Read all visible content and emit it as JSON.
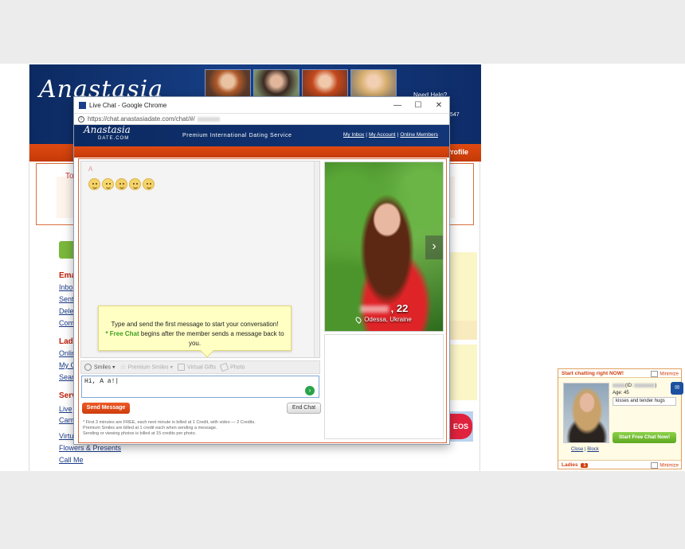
{
  "site": {
    "logo": "Anastasia",
    "help": "Need Help?",
    "phone": "547",
    "profile_link": "Profile",
    "box_to": "To",
    "sections": [
      {
        "label": "Ema",
        "links": [
          "Inbo",
          "Sent",
          "Dele",
          "Com"
        ]
      },
      {
        "label": "Ladi",
        "links": [
          "Onlin",
          "My C",
          "Sear"
        ]
      },
      {
        "label": "Serv",
        "links": [
          "Live",
          "Cam",
          "Virtu",
          "Flowers & Presents",
          "Call Me"
        ]
      }
    ],
    "right_button": "EOS"
  },
  "window": {
    "title": "Live Chat - Google Chrome",
    "minimize": "—",
    "maximize": "☐",
    "close": "✕",
    "url": "https://chat.anastasiadate.com/chat/#/"
  },
  "chat": {
    "logo_main": "Anastasia",
    "logo_sub": "DATE.COM",
    "tagline": "Premium International Dating Service",
    "links": [
      "My Inbox",
      "My Account",
      "Online Members"
    ],
    "link_sep": "|",
    "conversation_name": "A",
    "tip_line1": "Type and send the first message to start your conversation!",
    "tip_free_label": "* Free Chat",
    "tip_line2": " begins after the member sends a message back to you.",
    "toolbar": {
      "smiles": "Smiles",
      "premium_smiles": "Premium Smiles",
      "virtual_gifts": "Virtual Gifts",
      "photo": "Photo"
    },
    "message_value": "Hi, A      a!|",
    "send_label": "Send Message",
    "end_label": "End Chat",
    "fineprint": [
      "* First 3 minutes are FREE, each next minute is billed at 1 Credit, with video — 2 Credits.",
      "Premium Smiles are billed at 1 credit each when sending a message.",
      "Sending or viewing photos is billed at 15 credits per photo."
    ],
    "profile": {
      "age_suffix": ", 22",
      "city": "Odessa, Ukraine",
      "next": "›"
    }
  },
  "widget": {
    "header": "Start chatting right NOW!",
    "minimize": "Minimize",
    "id_label": "(ID:",
    "id_close": ")",
    "age": "Age: 45",
    "message": "kisses and tender hugs",
    "start_button": "Start Free Chat Now!",
    "close_link": "Close",
    "separator": "|",
    "block_link": "Block",
    "footer_label": "Ladies",
    "footer_count": "1",
    "side_icon": "chat"
  }
}
